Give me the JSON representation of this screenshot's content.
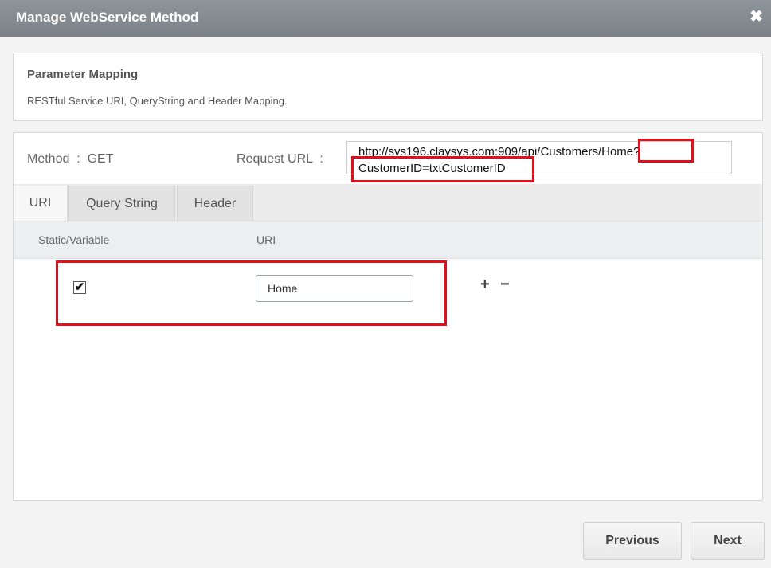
{
  "window": {
    "title": "Manage WebService Method",
    "close_icon": "close-icon",
    "close_glyph": "✖"
  },
  "section": {
    "title": "Parameter Mapping",
    "description": "RESTful Service URI, QueryString and Header Mapping."
  },
  "method": {
    "label": "Method  :  GET"
  },
  "request": {
    "label": "Request URL  :",
    "url_line1": "http://svs196.claysys.com:909/api/Customers/Home?",
    "url_line2": "CustomerID=txtCustomerID"
  },
  "tabs": [
    {
      "label": "URI",
      "active": true
    },
    {
      "label": "Query String",
      "active": false
    },
    {
      "label": "Header",
      "active": false
    }
  ],
  "table": {
    "headers": [
      "Static/Variable",
      "URI"
    ],
    "rows": [
      {
        "static_checked": true,
        "check_glyph": "✔",
        "uri_value": "Home"
      }
    ],
    "add_glyph": "+",
    "remove_glyph": "−"
  },
  "footer": {
    "previous_label": "Previous",
    "next_label": "Next"
  },
  "colors": {
    "highlight": "#e0101a",
    "titlebar": "#858c92"
  }
}
